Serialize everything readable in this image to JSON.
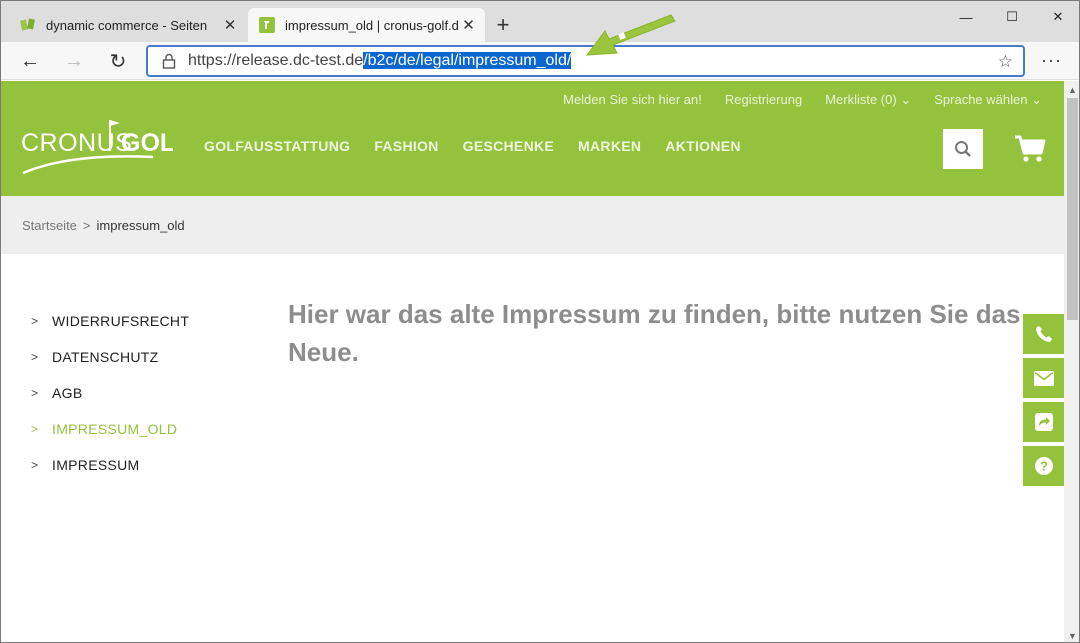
{
  "browser": {
    "tabs": [
      {
        "title": "dynamic commerce - Seiten",
        "close": "✕"
      },
      {
        "title": "impressum_old | cronus-golf.de",
        "close": "✕"
      }
    ],
    "new_tab": "+",
    "window_controls": {
      "minimize": "—",
      "maximize": "☐",
      "close": "✕"
    },
    "nav": {
      "back": "←",
      "forward": "→",
      "reload": "↻",
      "more": "···"
    },
    "address": {
      "url_plain": "https://release.dc-test.de",
      "url_selected": "/b2c/de/legal/impressum_old/",
      "favorite_icon": "☆"
    }
  },
  "site": {
    "topnav": {
      "login": "Melden Sie sich hier an!",
      "register": "Registrierung",
      "wishlist": "Merkliste (0)",
      "language": "Sprache wählen"
    },
    "logo": {
      "left": "CRONUS",
      "right": "GOLF"
    },
    "mainnav": [
      "GOLFAUSSTATTUNG",
      "FASHION",
      "GESCHENKE",
      "MARKEN",
      "AKTIONEN"
    ],
    "breadcrumb": {
      "home": "Startseite",
      "separator": ">",
      "current": "impressum_old"
    },
    "sidenav": [
      {
        "label": "WIDERRUFSRECHT",
        "active": false
      },
      {
        "label": "DATENSCHUTZ",
        "active": false
      },
      {
        "label": "AGB",
        "active": false
      },
      {
        "label": "IMPRESSUM_OLD",
        "active": true
      },
      {
        "label": "IMPRESSUM",
        "active": false
      }
    ],
    "content": {
      "text": "Hier war das alte Impressum zu finden, bitte nutzen Sie das Neue."
    },
    "float_icons": [
      "phone-icon",
      "envelope-icon",
      "share-icon",
      "help-icon"
    ],
    "colors": {
      "brand_green": "#95c23d",
      "text_grey": "#8d8d8d",
      "selection_blue": "#0c66cf"
    }
  }
}
